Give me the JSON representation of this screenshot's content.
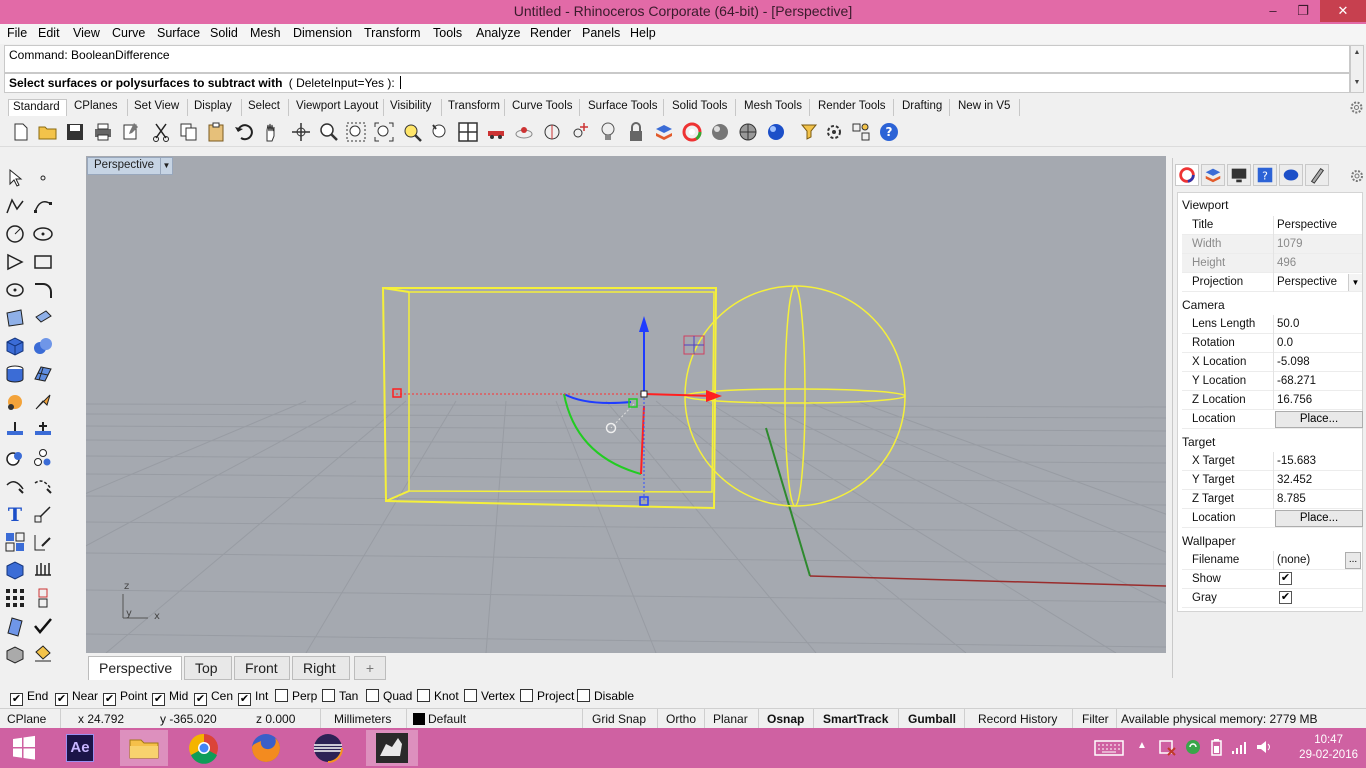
{
  "window": {
    "title": "Untitled - Rhinoceros Corporate (64-bit) - [Perspective]",
    "controls": [
      "–",
      "❐",
      "✕"
    ]
  },
  "menu": [
    "File",
    "Edit",
    "View",
    "Curve",
    "Surface",
    "Solid",
    "Mesh",
    "Dimension",
    "Transform",
    "Tools",
    "Analyze",
    "Render",
    "Panels",
    "Help"
  ],
  "command": {
    "history": "Command: BooleanDifference",
    "prompt": "Select surfaces or polysurfaces to subtract with",
    "option": "( DeleteInput=Yes ):"
  },
  "toolbar_tabs": [
    "Standard",
    "CPlanes",
    "Set View",
    "Display",
    "Select",
    "Viewport Layout",
    "Visibility",
    "Transform",
    "Curve Tools",
    "Surface Tools",
    "Solid Tools",
    "Mesh Tools",
    "Render Tools",
    "Drafting",
    "New in V5"
  ],
  "viewport": {
    "title": "Perspective",
    "axis_z": "z",
    "axis_y": "y",
    "axis_x": "x"
  },
  "viewport_tabs": [
    "Perspective",
    "Top",
    "Front",
    "Right",
    "+"
  ],
  "properties": {
    "sections": {
      "viewport": "Viewport",
      "camera": "Camera",
      "target": "Target",
      "wallpaper": "Wallpaper"
    },
    "viewport_rows": [
      {
        "label": "Title",
        "value": "Perspective"
      },
      {
        "label": "Width",
        "value": "1079"
      },
      {
        "label": "Height",
        "value": "496"
      },
      {
        "label": "Projection",
        "value": "Perspective"
      }
    ],
    "camera_rows": [
      {
        "label": "Lens Length",
        "value": "50.0"
      },
      {
        "label": "Rotation",
        "value": "0.0"
      },
      {
        "label": "X Location",
        "value": "-5.098"
      },
      {
        "label": "Y Location",
        "value": "-68.271"
      },
      {
        "label": "Z Location",
        "value": "16.756"
      },
      {
        "label": "Location",
        "value": "Place..."
      }
    ],
    "target_rows": [
      {
        "label": "X Target",
        "value": "-15.683"
      },
      {
        "label": "Y Target",
        "value": "32.452"
      },
      {
        "label": "Z Target",
        "value": "8.785"
      },
      {
        "label": "Location",
        "value": "Place..."
      }
    ],
    "wallpaper_rows": [
      {
        "label": "Filename",
        "value": "(none)"
      },
      {
        "label": "Show",
        "value": "✔"
      },
      {
        "label": "Gray",
        "value": "✔"
      }
    ],
    "browse": "..."
  },
  "osnaps": [
    {
      "label": "End",
      "checked": true
    },
    {
      "label": "Near",
      "checked": true
    },
    {
      "label": "Point",
      "checked": true
    },
    {
      "label": "Mid",
      "checked": true
    },
    {
      "label": "Cen",
      "checked": true
    },
    {
      "label": "Int",
      "checked": true
    },
    {
      "label": "Perp",
      "checked": false
    },
    {
      "label": "Tan",
      "checked": false
    },
    {
      "label": "Quad",
      "checked": false
    },
    {
      "label": "Knot",
      "checked": false
    },
    {
      "label": "Vertex",
      "checked": false
    },
    {
      "label": "Project",
      "checked": false
    },
    {
      "label": "Disable",
      "checked": false
    }
  ],
  "status": {
    "cplane": "CPlane",
    "x": "x 24.792",
    "y": "y -365.020",
    "z": "z 0.000",
    "units": "Millimeters",
    "layer": "Default",
    "grid_snap": "Grid Snap",
    "ortho": "Ortho",
    "planar": "Planar",
    "osnap": "Osnap",
    "smarttrack": "SmartTrack",
    "gumball": "Gumball",
    "record_history": "Record History",
    "filter": "Filter",
    "memory": "Available physical memory: 2779 MB"
  },
  "taskbar": {
    "time": "10:47",
    "date": "29-02-2016",
    "ae_label": "Ae"
  },
  "colors": {
    "titlebar": "#e26aa7",
    "taskbar": "#cf61a2",
    "viewport_bg": "#a5a9b0",
    "selection": "#ffff33"
  }
}
